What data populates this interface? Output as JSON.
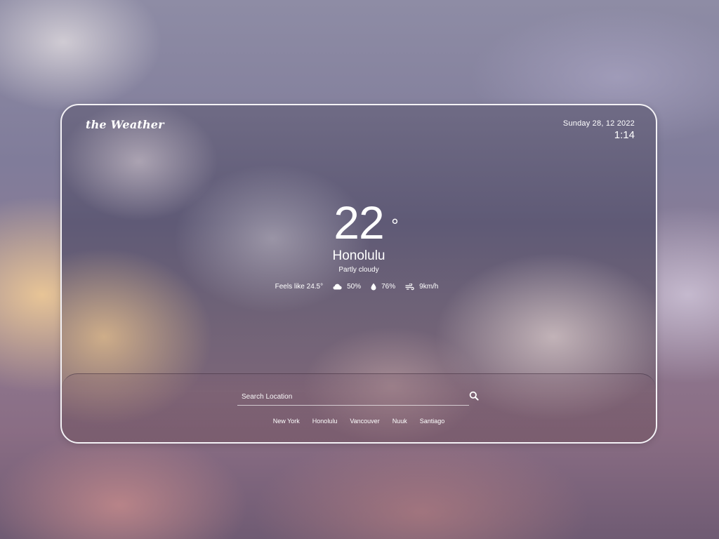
{
  "app": {
    "brand": "the Weather"
  },
  "header": {
    "date": "Sunday 28, 12 2022",
    "time": "1:14"
  },
  "current": {
    "temperature": "22",
    "unit": "°",
    "city": "Honolulu",
    "condition": "Partly cloudy"
  },
  "stats": {
    "feels_like": "Feels like 24.5°",
    "cloudiness": "50%",
    "humidity": "76%",
    "wind": "9km/h",
    "icons": [
      "cloud-icon",
      "water-drop-icon",
      "wind-icon"
    ]
  },
  "search": {
    "placeholder": "Search Location",
    "value": ""
  },
  "quick_cities": [
    "New York",
    "Honolulu",
    "Vancouver",
    "Nuuk",
    "Santiago"
  ],
  "colors": {
    "text": "#ffffff",
    "card_border": "#f4f2f6"
  }
}
